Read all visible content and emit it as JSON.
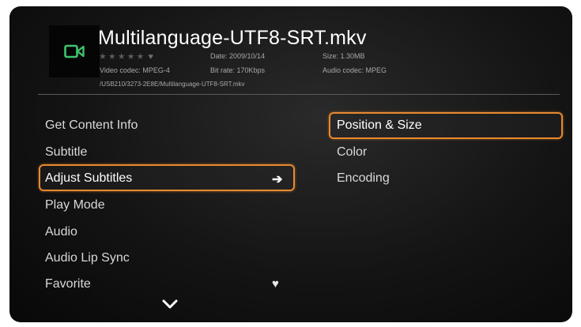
{
  "file": {
    "title": "Multilanguage-UTF8-SRT.mkv",
    "rating_stars": "★★★★★",
    "rating_heart": "♥",
    "date": "Date: 2009/10/14",
    "size": "Size: 1.30MB",
    "video_codec": "Video codec: MPEG-4",
    "bit_rate": "Bit rate: 170Kbps",
    "audio_codec": "Audio codec: MPEG",
    "path": "/USB210/3273-2E8E/Multilanguage-UTF8-SRT.mkv",
    "thumbnail_icon": "video-camera-icon"
  },
  "left_menu": {
    "items": [
      {
        "label": "Get Content Info"
      },
      {
        "label": "Subtitle"
      },
      {
        "label": "Adjust Subtitles",
        "selected": true,
        "arrow": "➔"
      },
      {
        "label": "Play Mode"
      },
      {
        "label": "Audio"
      },
      {
        "label": "Audio Lip Sync"
      },
      {
        "label": "Favorite",
        "icon": "♥"
      }
    ],
    "more_icon": "chevron-down-icon"
  },
  "right_menu": {
    "items": [
      {
        "label": "Position & Size",
        "selected": true
      },
      {
        "label": "Color"
      },
      {
        "label": "Encoding"
      }
    ]
  },
  "colors": {
    "focus": "#e8892e",
    "camera_icon": "#3ec46d",
    "background": "#141414"
  }
}
